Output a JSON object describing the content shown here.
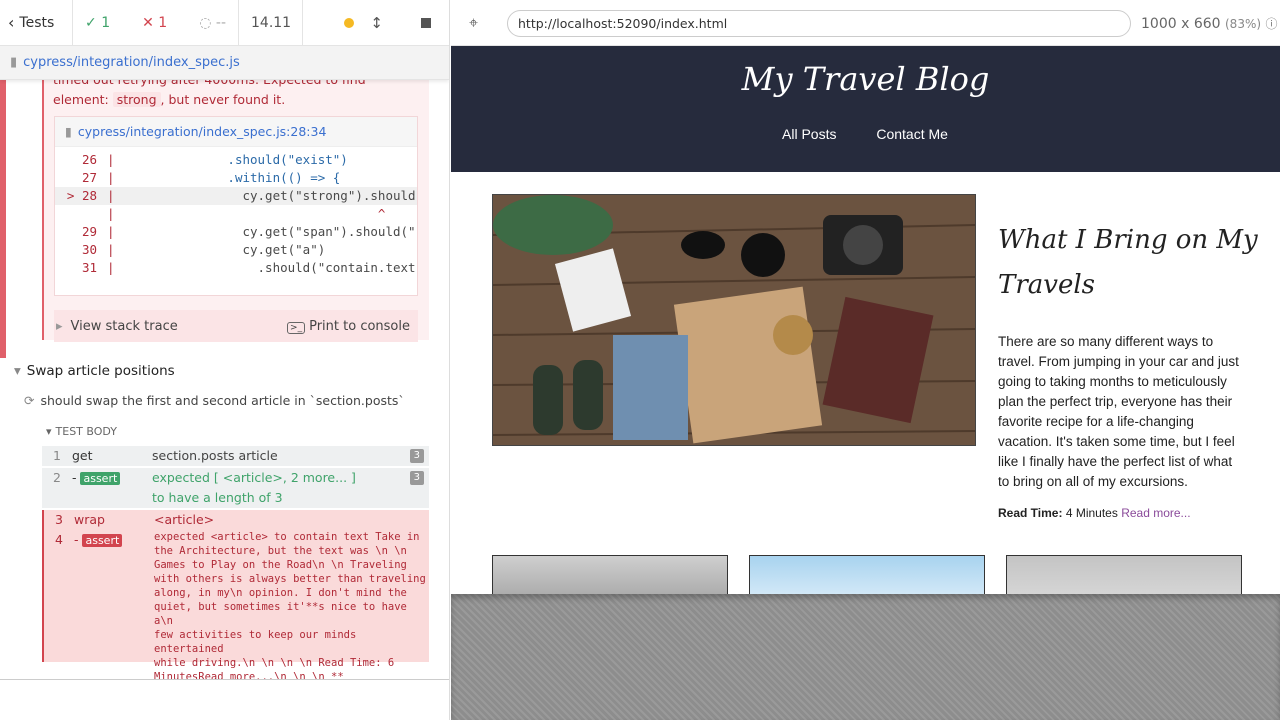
{
  "runner": {
    "tests_label": "Tests",
    "passed_count": "1",
    "failed_count": "1",
    "pending_count": "--",
    "duration": "14.11",
    "spec_path": "cypress/integration/index_spec.js"
  },
  "error": {
    "message_line1": "timed out retrying after 4000ms: Expected to find",
    "message_line2_prefix": "element: ",
    "message_code": "strong",
    "message_line2_suffix": ", but never found it.",
    "frame_file": "cypress/integration/index_spec.js:28:34",
    "code_lines": [
      {
        "num": "26",
        "code": "               .should(\"exist\")"
      },
      {
        "num": "27",
        "code": "               .within(() => {"
      },
      {
        "num": "> 28",
        "code": "                 cy.get(\"strong\").should"
      },
      {
        "num": "",
        "code": "                                   ^"
      },
      {
        "num": "29",
        "code": "                 cy.get(\"span\").should(\""
      },
      {
        "num": "30",
        "code": "                 cy.get(\"a\")"
      },
      {
        "num": "31",
        "code": "                   .should(\"contain.text"
      }
    ],
    "stack_label": "View stack trace",
    "print_label": "Print to console"
  },
  "suite": {
    "title": "Swap article positions",
    "test_title": "should swap the first and second article in `section.posts`",
    "body_label": "TEST BODY",
    "commands": [
      {
        "num": "1",
        "name": "get",
        "msg": "section.posts article",
        "count": "3"
      },
      {
        "num": "2",
        "name": "assert",
        "msg_a": "expected [ <article>, 2 more... ]",
        "msg_b": "to have a length of 3",
        "count": "3"
      },
      {
        "num": "3",
        "name": "wrap",
        "msg": "<article>"
      },
      {
        "num": "4",
        "name": "assert",
        "msg": "expected <article> to contain text Take in\nthe Architecture, but the text was \\n \\n\nGames to Play on the Road\\n \\n Traveling\nwith others is always better than traveling\nalong, in my\\n opinion. I don't mind the\nquiet, but sometimes it'**s nice to have a\\n\nfew activities to keep our minds entertained\nwhile driving.\\n \\n \\n \\n Read Time: 6\nMinutesRead more...\\n \\n \\n **"
      }
    ]
  },
  "browser": {
    "url": "http://localhost:52090/index.html",
    "viewport": "1000 x 660",
    "scale": "(83%)"
  },
  "blog": {
    "title": "My Travel Blog",
    "nav": [
      "All Posts",
      "Contact Me"
    ],
    "article_title": "What I Bring on My Travels",
    "article_body": "There are so many different ways to travel. From jumping in your car and just going to taking months to meticulously plan the perfect trip, everyone has their favorite recipe for a life-changing vacation. It's taken some time, but I feel like I finally have the perfect list of what to bring on all of my excursions.",
    "read_time_label": "Read Time:",
    "read_time_value": "4 Minutes",
    "read_more": "Read more..."
  },
  "colors": {
    "header_bg": "#262b3d",
    "pass": "#3fa36a",
    "fail": "#d2444e",
    "link": "#3a6fcf"
  }
}
